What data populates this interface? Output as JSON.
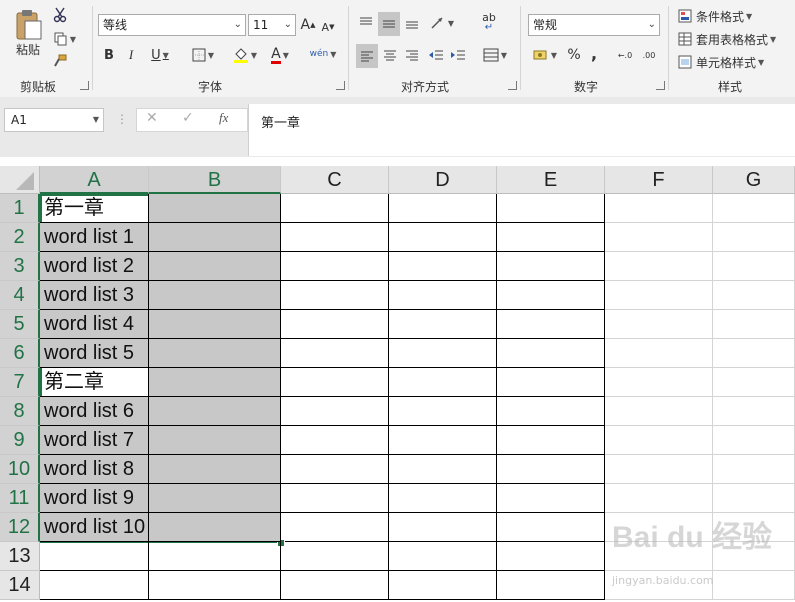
{
  "ribbon": {
    "clipboard": {
      "group_label": "剪贴板",
      "paste_label": "粘贴"
    },
    "font": {
      "group_label": "字体",
      "font_name": "等线",
      "font_size": "11",
      "bold": "B",
      "italic": "I",
      "underline": "U",
      "grow": "A",
      "shrink": "A",
      "font_color_glyph": "A",
      "phonetic": "wén"
    },
    "alignment": {
      "group_label": "对齐方式",
      "wrap_glyph": "ab"
    },
    "number": {
      "group_label": "数字",
      "format": "常规",
      "percent": "%",
      "comma": ",",
      "inc_decimal": "←.0",
      "dec_decimal": ".00"
    },
    "styles": {
      "group_label": "样式",
      "conditional": "条件格式",
      "table": "套用表格格式",
      "cell_styles": "单元格样式"
    }
  },
  "formula_bar": {
    "name_box": "A1",
    "fx": "fx",
    "cancel": "✕",
    "enter": "✓",
    "content": "第一章"
  },
  "columns": [
    "A",
    "B",
    "C",
    "D",
    "E",
    "F",
    "G"
  ],
  "rows": [
    "1",
    "2",
    "3",
    "4",
    "5",
    "6",
    "7",
    "8",
    "9",
    "10",
    "11",
    "12",
    "13",
    "14"
  ],
  "cells_a": [
    "第一章",
    "word list 1",
    "word list 2",
    "word list 3",
    "word list 4",
    "word list 5",
    "第二章",
    "word list 6",
    "word list 7",
    "word list 8",
    "word list 9",
    "word list 10",
    "",
    ""
  ],
  "watermark": {
    "main": "Bai du 经验",
    "sub": "jingyan.baidu.com"
  }
}
